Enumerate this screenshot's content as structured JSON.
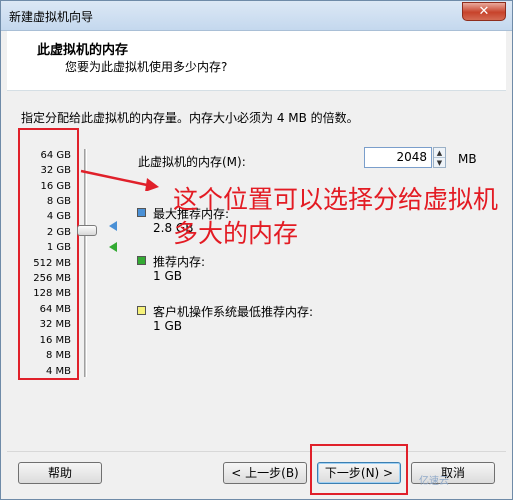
{
  "window": {
    "title": "新建虚拟机向导",
    "close_glyph": "✕"
  },
  "header": {
    "title": "此虚拟机的内存",
    "subtitle": "您要为此虚拟机使用多少内存?"
  },
  "instruction": "指定分配给此虚拟机的内存量。内存大小必须为 4 MB 的倍数。",
  "memory_scale": [
    "64 GB",
    "32 GB",
    "16 GB",
    "8 GB",
    "4 GB",
    "2 GB",
    "1 GB",
    "512 MB",
    "256 MB",
    "128 MB",
    "64 MB",
    "32 MB",
    "16 MB",
    "8 MB",
    "4 MB"
  ],
  "slider": {
    "selected_value": "2048 MB"
  },
  "memory_field": {
    "label": "此虚拟机的内存(M):",
    "value": "2048",
    "unit": "MB"
  },
  "legend": [
    {
      "title": "最大推荐内存:",
      "value": "2.8 GB",
      "color": "#4a90d6"
    },
    {
      "title": "推荐内存:",
      "value": "1 GB",
      "color": "#33aa33"
    },
    {
      "title": "客户机操作系统最低推荐内存:",
      "value": "1 GB",
      "color": "#f6f27a"
    }
  ],
  "annotation": "这个位置可以选择分给虚拟机多大的内存",
  "buttons": {
    "help": "帮助",
    "back": "< 上一步(B)",
    "next": "下一步(N) >",
    "cancel": "取消"
  },
  "watermark": "亿速云"
}
